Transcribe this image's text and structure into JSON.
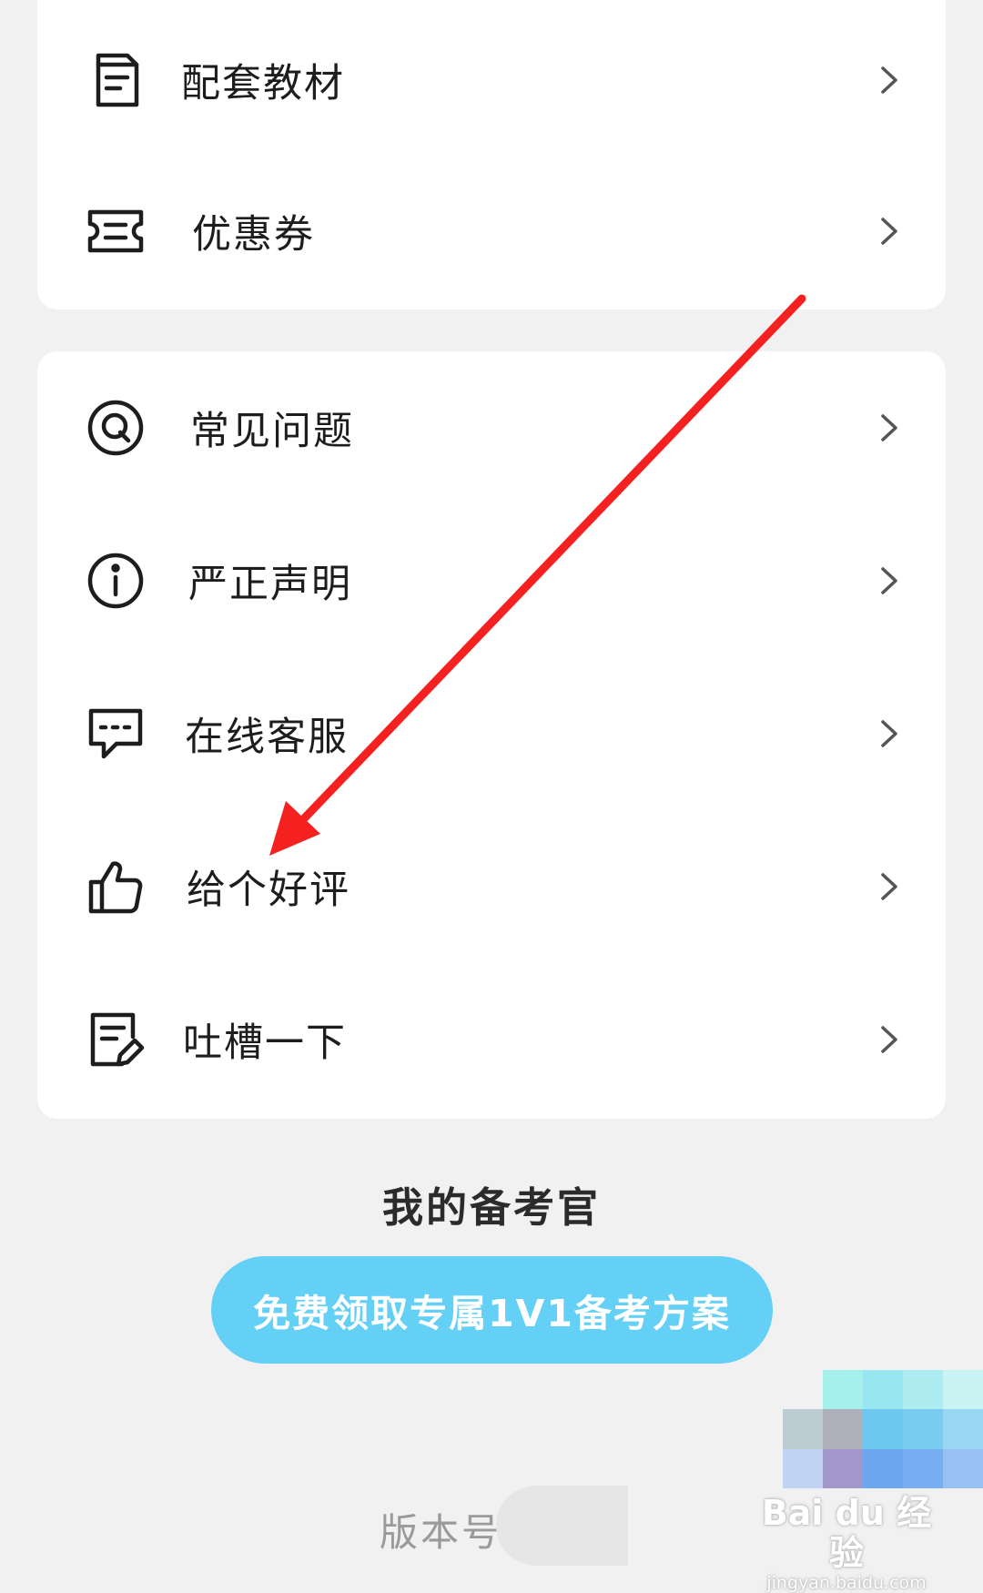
{
  "menu_group_1": {
    "items": [
      {
        "label": "配套教材",
        "icon": "document-icon"
      },
      {
        "label": "优惠券",
        "icon": "ticket-icon"
      }
    ]
  },
  "menu_group_2": {
    "items": [
      {
        "label": "常见问题",
        "icon": "faq-icon"
      },
      {
        "label": "严正声明",
        "icon": "info-icon"
      },
      {
        "label": "在线客服",
        "icon": "chat-icon"
      },
      {
        "label": "给个好评",
        "icon": "thumbs-up-icon"
      },
      {
        "label": "吐槽一下",
        "icon": "feedback-edit-icon"
      }
    ]
  },
  "beikao": {
    "title": "我的备考官",
    "cta_label": "免费领取专属1V1备考方案"
  },
  "footer": {
    "version_label": "版本号"
  },
  "watermark": {
    "main": "Bai du 经验",
    "sub": "jingyan.baidu.com"
  },
  "colors": {
    "page_bg": "#f1f1f1",
    "card_bg": "#ffffff",
    "cta_bg": "#64d0f5",
    "annotation_arrow": "#f52020"
  }
}
